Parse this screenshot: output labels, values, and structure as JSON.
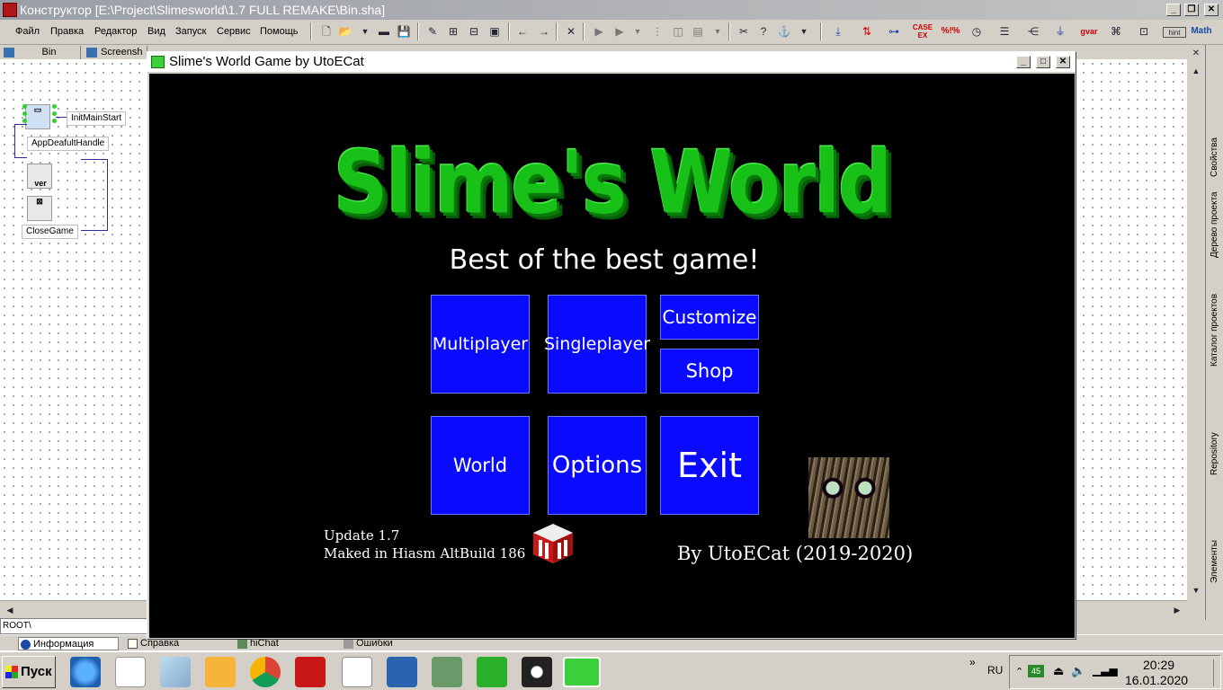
{
  "ide": {
    "title": "Конструктор [E:\\Project\\Slimesworld\\1.7 FULL REMAKE\\Bin.sha]",
    "menu": [
      "Файл",
      "Правка",
      "Редактор",
      "Вид",
      "Запуск",
      "Сервис",
      "Помощь"
    ],
    "doc_tabs": [
      "Bin",
      "Screensh"
    ],
    "root_path": "ROOT\\",
    "bottom_tabs": [
      "Информация",
      "Справка",
      "hiChat",
      "Ошибки"
    ],
    "right_tabs": [
      "Свойства",
      "Дерево проекта",
      "Каталог проектов",
      "Repository",
      "Элементы"
    ],
    "toolbar_right": [
      "CASE EX",
      "%!%",
      "gvar",
      "hint",
      "Math"
    ]
  },
  "canvas": {
    "elements": [
      "InitMainStart",
      "AppDeafultHandle",
      "CloseGame"
    ],
    "component_labels": [
      "ver"
    ]
  },
  "game_window": {
    "title": "Slime's World Game by UtoECat",
    "logo_text": "Slime's World",
    "subtitle": "Best of the best game!",
    "buttons": {
      "multiplayer": "Multiplayer",
      "singleplayer": "Singleplayer",
      "customize": "Customize",
      "shop": "Shop",
      "world": "World",
      "options": "Options",
      "exit": "Exit"
    },
    "update_line": "Update 1.7",
    "maked_line": "Maked in Hiasm AltBuild 186",
    "author": "By UtoECat (2019-2020)",
    "colors": {
      "button": "#0a0aff",
      "logo": "#17c117",
      "background": "#000000"
    }
  },
  "taskbar": {
    "start": "Пуск",
    "lang": "RU",
    "tray_badge": "45",
    "time": "20:29",
    "date": "16.01.2020"
  }
}
